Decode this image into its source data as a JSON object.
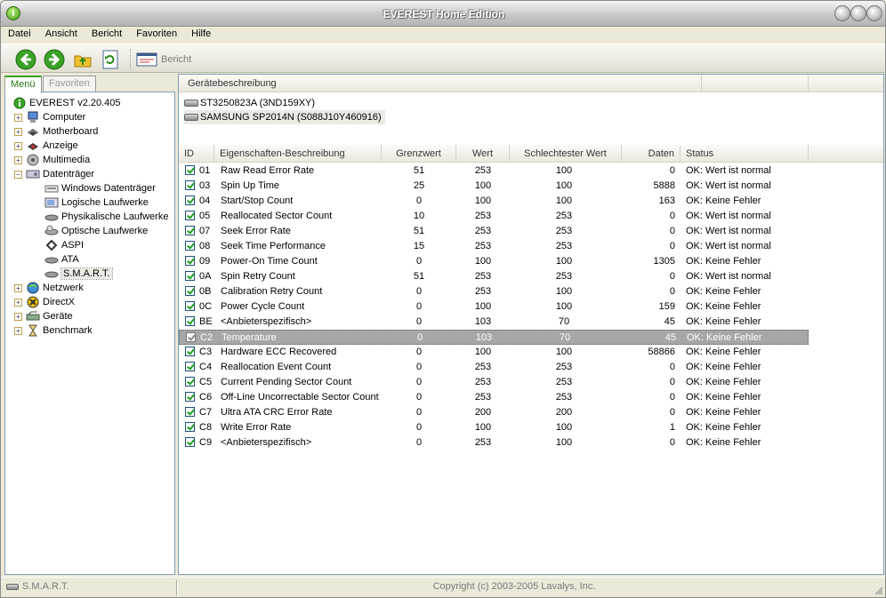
{
  "window": {
    "title": "EVEREST Home Edition"
  },
  "menu": [
    "Datei",
    "Ansicht",
    "Bericht",
    "Favoriten",
    "Hilfe"
  ],
  "toolbar": {
    "report_label": "Bericht"
  },
  "tabs": {
    "menu": "Menü",
    "favorites": "Favoriten"
  },
  "tree": {
    "root": "EVEREST v2.20.405",
    "items": [
      {
        "label": "Computer",
        "icon": "computer-icon"
      },
      {
        "label": "Motherboard",
        "icon": "motherboard-icon"
      },
      {
        "label": "Anzeige",
        "icon": "display-icon"
      },
      {
        "label": "Multimedia",
        "icon": "multimedia-icon"
      },
      {
        "label": "Datenträger",
        "icon": "storage-icon",
        "expanded": true
      },
      {
        "label": "Windows Datenträger",
        "icon": "drive-icon",
        "child": true
      },
      {
        "label": "Logische Laufwerke",
        "icon": "logical-drive-icon",
        "child": true
      },
      {
        "label": "Physikalische Laufwerke",
        "icon": "physical-drive-icon",
        "child": true
      },
      {
        "label": "Optische Laufwerke",
        "icon": "optical-drive-icon",
        "child": true
      },
      {
        "label": "ASPI",
        "icon": "aspi-icon",
        "child": true
      },
      {
        "label": "ATA",
        "icon": "ata-icon",
        "child": true
      },
      {
        "label": "S.M.A.R.T.",
        "icon": "smart-icon",
        "child": true,
        "selected": true
      },
      {
        "label": "Netzwerk",
        "icon": "network-icon"
      },
      {
        "label": "DirectX",
        "icon": "directx-icon"
      },
      {
        "label": "Geräte",
        "icon": "devices-icon"
      },
      {
        "label": "Benchmark",
        "icon": "benchmark-icon"
      }
    ]
  },
  "devices": {
    "header": "Gerätebeschreibung",
    "items": [
      "ST3250823A (3ND159XY)",
      "SAMSUNG SP2014N (S088J10Y460916)"
    ]
  },
  "table": {
    "headers": [
      "ID",
      "Eigenschaften-Beschreibung",
      "Grenzwert",
      "Wert",
      "Schlechtester Wert",
      "Daten",
      "Status"
    ],
    "rows": [
      [
        "01",
        "Raw Read Error Rate",
        "51",
        "253",
        "100",
        "0",
        "OK: Wert ist normal"
      ],
      [
        "03",
        "Spin Up Time",
        "25",
        "100",
        "100",
        "5888",
        "OK: Wert ist normal"
      ],
      [
        "04",
        "Start/Stop Count",
        "0",
        "100",
        "100",
        "163",
        "OK: Keine Fehler"
      ],
      [
        "05",
        "Reallocated Sector Count",
        "10",
        "253",
        "253",
        "0",
        "OK: Wert ist normal"
      ],
      [
        "07",
        "Seek Error Rate",
        "51",
        "253",
        "253",
        "0",
        "OK: Wert ist normal"
      ],
      [
        "08",
        "Seek Time Performance",
        "15",
        "253",
        "253",
        "0",
        "OK: Wert ist normal"
      ],
      [
        "09",
        "Power-On Time Count",
        "0",
        "100",
        "100",
        "1305",
        "OK: Keine Fehler"
      ],
      [
        "0A",
        "Spin Retry Count",
        "51",
        "253",
        "253",
        "0",
        "OK: Wert ist normal"
      ],
      [
        "0B",
        "Calibration Retry Count",
        "0",
        "253",
        "100",
        "0",
        "OK: Keine Fehler"
      ],
      [
        "0C",
        "Power Cycle Count",
        "0",
        "100",
        "100",
        "159",
        "OK: Keine Fehler"
      ],
      [
        "BE",
        "<Anbieterspezifisch>",
        "0",
        "103",
        "70",
        "45",
        "OK: Keine Fehler"
      ],
      [
        "C2",
        "Temperature",
        "0",
        "103",
        "70",
        "45",
        "OK: Keine Fehler"
      ],
      [
        "C3",
        "Hardware ECC Recovered",
        "0",
        "100",
        "100",
        "58866",
        "OK: Keine Fehler"
      ],
      [
        "C4",
        "Reallocation Event Count",
        "0",
        "253",
        "253",
        "0",
        "OK: Keine Fehler"
      ],
      [
        "C5",
        "Current Pending Sector Count",
        "0",
        "253",
        "253",
        "0",
        "OK: Keine Fehler"
      ],
      [
        "C6",
        "Off-Line Uncorrectable Sector Count",
        "0",
        "253",
        "253",
        "0",
        "OK: Keine Fehler"
      ],
      [
        "C7",
        "Ultra ATA CRC Error Rate",
        "0",
        "200",
        "200",
        "0",
        "OK: Keine Fehler"
      ],
      [
        "C8",
        "Write Error Rate",
        "0",
        "100",
        "100",
        "1",
        "OK: Keine Fehler"
      ],
      [
        "C9",
        "<Anbieterspezifisch>",
        "0",
        "253",
        "100",
        "0",
        "OK: Keine Fehler"
      ]
    ],
    "selected_row": 11
  },
  "statusbar": {
    "left": "S.M.A.R.T.",
    "center": "Copyright (c) 2003-2005 Lavalys, Inc."
  }
}
